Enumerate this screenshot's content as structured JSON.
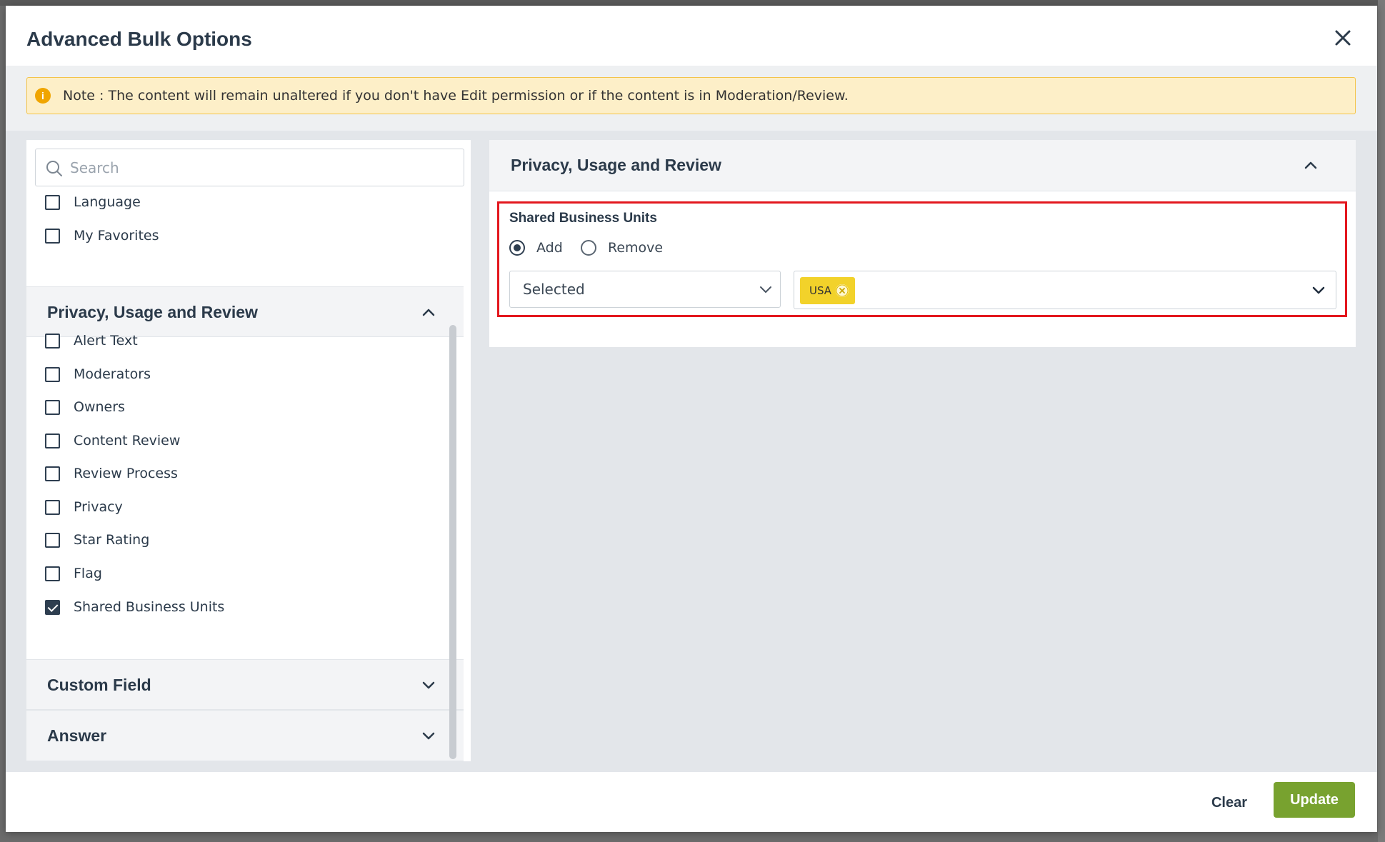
{
  "modal": {
    "title": "Advanced Bulk Options"
  },
  "note": {
    "text": "Note : The content will remain unaltered if you don't have Edit permission or if the content is in Moderation/Review."
  },
  "left_panel": {
    "search_placeholder": "Search",
    "top_items": [
      {
        "label": "Language",
        "checked": false
      },
      {
        "label": "My Favorites",
        "checked": false
      }
    ],
    "sections": [
      {
        "title": "Privacy, Usage and Review",
        "expanded": true,
        "items": [
          {
            "label": "Alert Text",
            "checked": false
          },
          {
            "label": "Moderators",
            "checked": false
          },
          {
            "label": "Owners",
            "checked": false
          },
          {
            "label": "Content Review",
            "checked": false
          },
          {
            "label": "Review Process",
            "checked": false
          },
          {
            "label": "Privacy",
            "checked": false
          },
          {
            "label": "Star Rating",
            "checked": false
          },
          {
            "label": "Flag",
            "checked": false
          },
          {
            "label": "Shared Business Units",
            "checked": true
          }
        ]
      },
      {
        "title": "Custom Field",
        "expanded": false
      },
      {
        "title": "Answer",
        "expanded": false
      }
    ]
  },
  "right_panel": {
    "title": "Privacy, Usage and Review",
    "field_label": "Shared Business Units",
    "radio_options": [
      {
        "label": "Add",
        "selected": true
      },
      {
        "label": "Remove",
        "selected": false
      }
    ],
    "select_value": "Selected",
    "tags": [
      "USA"
    ]
  },
  "footer": {
    "clear_label": "Clear",
    "update_label": "Update"
  },
  "colors": {
    "update_button": "#78a22f",
    "tag": "#f2d22a",
    "highlight_border": "#e3171e",
    "note_background": "#fdefc8"
  }
}
